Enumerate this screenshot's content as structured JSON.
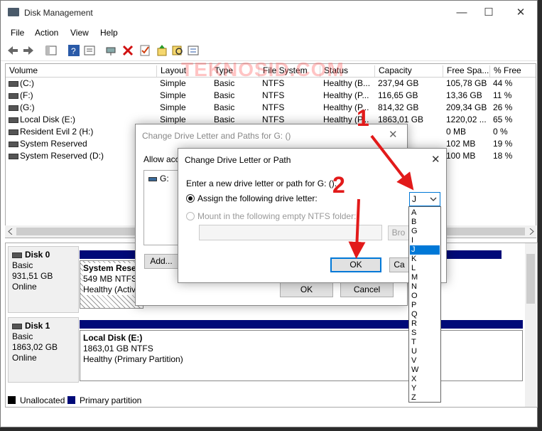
{
  "window": {
    "title": "Disk Management"
  },
  "menu": [
    "File",
    "Action",
    "View",
    "Help"
  ],
  "volume_table": {
    "headers": [
      "Volume",
      "Layout",
      "Type",
      "File System",
      "Status",
      "Capacity",
      "Free Spa...",
      "% Free"
    ],
    "rows": [
      [
        "(C:)",
        "Simple",
        "Basic",
        "NTFS",
        "Healthy (B...",
        "237,94 GB",
        "105,78 GB",
        "44 %"
      ],
      [
        "(F:)",
        "Simple",
        "Basic",
        "NTFS",
        "Healthy (P...",
        "116,65 GB",
        "13,36 GB",
        "11 %"
      ],
      [
        "(G:)",
        "Simple",
        "Basic",
        "NTFS",
        "Healthy (P...",
        "814,32 GB",
        "209,34 GB",
        "26 %"
      ],
      [
        "Local Disk (E:)",
        "Simple",
        "Basic",
        "NTFS",
        "Healthy (P...",
        "1863,01 GB",
        "1220,02 ...",
        "65 %"
      ],
      [
        "Resident Evil 2 (H:)",
        "",
        "",
        "",
        "",
        "B",
        "0 MB",
        "0 %"
      ],
      [
        "System Reserved",
        "",
        "",
        "",
        "",
        "B",
        "102 MB",
        "19 %"
      ],
      [
        "System Reserved (D:)",
        "",
        "",
        "",
        "",
        "B",
        "100 MB",
        "18 %"
      ]
    ]
  },
  "watermark": "TEKNOSID.COM",
  "disks": [
    {
      "name": "Disk 0",
      "type": "Basic",
      "size": "931,51 GB",
      "status": "Online",
      "part_name": "System Rese",
      "part_size": "549 MB NTFS",
      "part_status": "Healthy (Activ"
    },
    {
      "name": "Disk 1",
      "type": "Basic",
      "size": "1863,02 GB",
      "status": "Online",
      "part_name": "Local Disk  (E:)",
      "part_size": "1863,01 GB NTFS",
      "part_status": "Healthy (Primary Partition)"
    }
  ],
  "legend": {
    "unallocated": "Unallocated",
    "primary": "Primary partition"
  },
  "edge_text": "ft",
  "dialog_paths": {
    "title": "Change Drive Letter and Paths for G: ()",
    "allow": "Allow acce",
    "list_item": "G:",
    "add": "Add...",
    "ok": "OK",
    "cancel": "Cancel"
  },
  "dialog_letter": {
    "title": "Change Drive Letter or Path",
    "prompt": "Enter a new drive letter or path for G: ().",
    "assign_label": "Assign the following drive letter:",
    "mount_label": "Mount in the following empty NTFS folder:",
    "browse": "Bro",
    "ok": "OK",
    "cancel": "Ca",
    "selected_letter": "J",
    "letters": [
      "A",
      "B",
      "G",
      "I",
      "J",
      "K",
      "L",
      "M",
      "N",
      "O",
      "P",
      "Q",
      "R",
      "S",
      "T",
      "U",
      "V",
      "W",
      "X",
      "Y",
      "Z"
    ]
  },
  "annotations": {
    "step1": "1",
    "step2": "2"
  },
  "colors": {
    "primary_partition": "#000a78",
    "selection": "#0078d7",
    "annotation": "#e21a1a"
  }
}
